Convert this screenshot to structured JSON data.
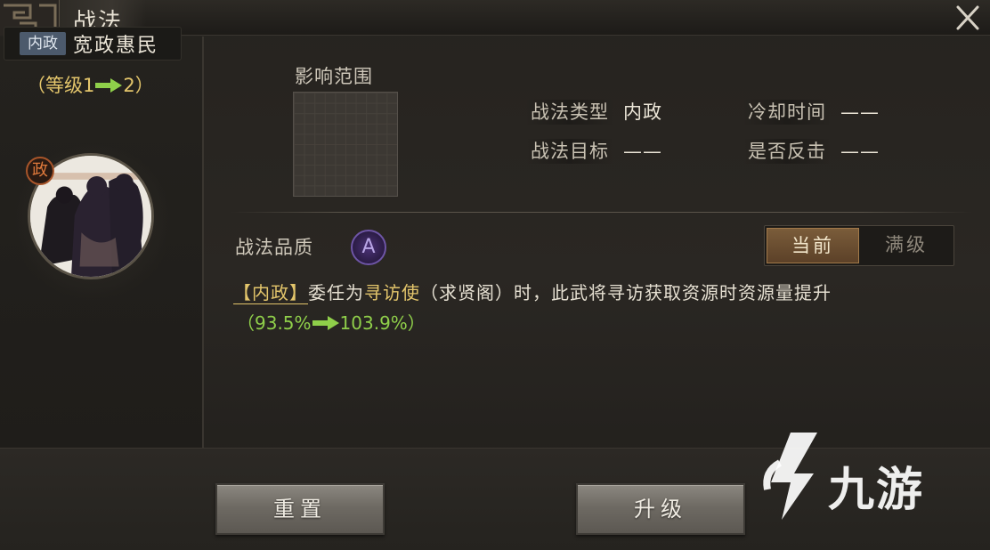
{
  "window": {
    "title": "战法"
  },
  "skill": {
    "type_tag": "内政",
    "name": "宽政惠民",
    "level_open": "（等级1",
    "level_close": "2）",
    "general_badge": "政"
  },
  "range": {
    "label": "影响范围"
  },
  "attributes": {
    "type_key": "战法类型",
    "type_val": "内政",
    "cooldown_key": "冷却时间",
    "cooldown_val": "——",
    "target_key": "战法目标",
    "target_val": "——",
    "counter_key": "是否反击",
    "counter_val": "——"
  },
  "quality": {
    "label": "战法品质",
    "grade": "A"
  },
  "toggle": {
    "current": "当前",
    "max": "满级",
    "selected": "current"
  },
  "description": {
    "tag": "【内政】",
    "part1": "委任为",
    "highlight": "寻访使",
    "part2": "（求贤阁）时，此武将寻访获取资源时资源量提升",
    "value_open": "（93.5%",
    "value_close": "103.9%）"
  },
  "buttons": {
    "reset": "重置",
    "upgrade": "升级"
  },
  "watermark": {
    "text": "九游"
  },
  "colors": {
    "gold": "#e3c56b",
    "green": "#8fcf4a",
    "purple": "#6e55a6",
    "orange": "#e07a3c"
  }
}
